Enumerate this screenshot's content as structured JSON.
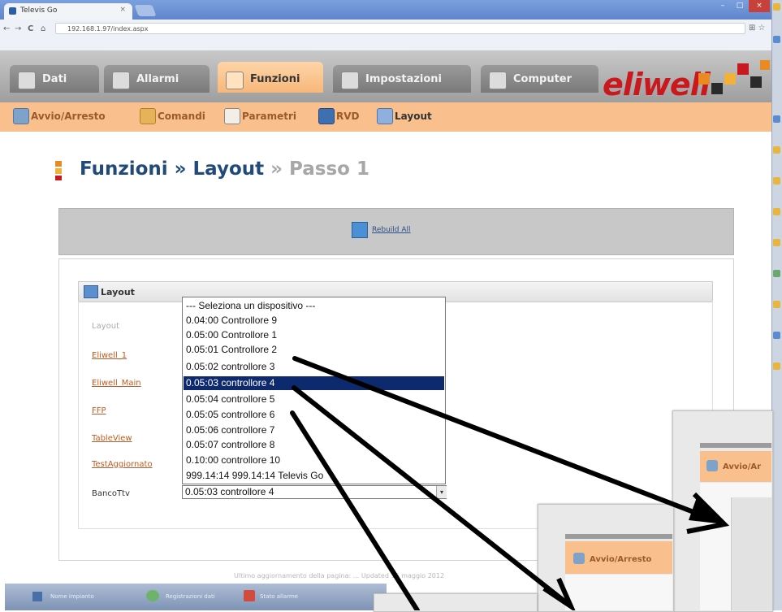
{
  "browser": {
    "tab_title": "Televis Go",
    "tab_close": "×",
    "url": "192.168.1.97/index.aspx",
    "window_buttons": [
      "–",
      "□",
      "×"
    ],
    "nav_back": "←",
    "nav_forward": "→",
    "nav_reload": "C",
    "nav_home": "⌂",
    "toolbar_icons": "⊞ ☆"
  },
  "main_tabs": [
    {
      "label": "Dati",
      "icon": "data-icon"
    },
    {
      "label": "Allarmi",
      "icon": "alarm-icon"
    },
    {
      "label": "Funzioni",
      "icon": "tools-icon",
      "active": true
    },
    {
      "label": "Impostazioni",
      "icon": "settings-icon"
    },
    {
      "label": "Computer",
      "icon": "computer-icon"
    }
  ],
  "logo": {
    "text": "eliwell"
  },
  "sub_nav": [
    {
      "label": "Avvio/Arresto",
      "icon": "power-icon"
    },
    {
      "label": "Comandi",
      "icon": "command-icon"
    },
    {
      "label": "Parametri",
      "icon": "parameters-icon"
    },
    {
      "label": "RVD",
      "icon": "rvd-icon"
    },
    {
      "label": "Layout",
      "icon": "layout-icon"
    }
  ],
  "heading": {
    "part1": "Funzioni » Layout",
    "part2": " » Passo 1"
  },
  "rebuild_link": "Rebuild All",
  "panel": {
    "title": "Layout",
    "rows": [
      {
        "label": "Layout",
        "style": "gray"
      },
      {
        "label": "Eliwell_1",
        "style": "link"
      },
      {
        "label": "Eliwell_Main",
        "style": "link"
      },
      {
        "label": "FFP",
        "style": "link"
      },
      {
        "label": "TableView",
        "style": "link"
      },
      {
        "label": "TestAggiornato",
        "style": "link"
      },
      {
        "label": "BancoTtv",
        "style": "dark"
      }
    ]
  },
  "dropdown": {
    "options": [
      "--- Seleziona un dispositivo ---",
      "0.04:00 Controllore 9",
      "0.05:00 Controllore 1",
      "0.05:01 Controllore 2",
      "0.05:02 controllore 3",
      "0.05:03 controllore 4",
      "0.05:04 controllore 5",
      "0.05:05 controllore 6",
      "0.05:06 controllore 7",
      "0.05:07 controllore 8",
      "0.10:00 controllore 10",
      "999.14:14 999.14:14 Televis Go"
    ],
    "selected_index": 5,
    "selected_value": "0.05:03 controllore 4",
    "arrow": "▾"
  },
  "footer": "Ultimo aggiornamento della pagina: ... Updated 15 maggio 2012",
  "taskbar": {
    "items": [
      "Nome impianto",
      "Registrazioni dati",
      "Stato allarme"
    ]
  },
  "thumbnails": [
    {
      "label": "Avvio/Ar"
    },
    {
      "label": "Avvio/Arresto"
    }
  ],
  "colors": {
    "orange_bar": "#f9c08d",
    "selected_option": "#0d2a6e",
    "brand_red": "#c9191e",
    "heading_blue": "#214a7a"
  }
}
